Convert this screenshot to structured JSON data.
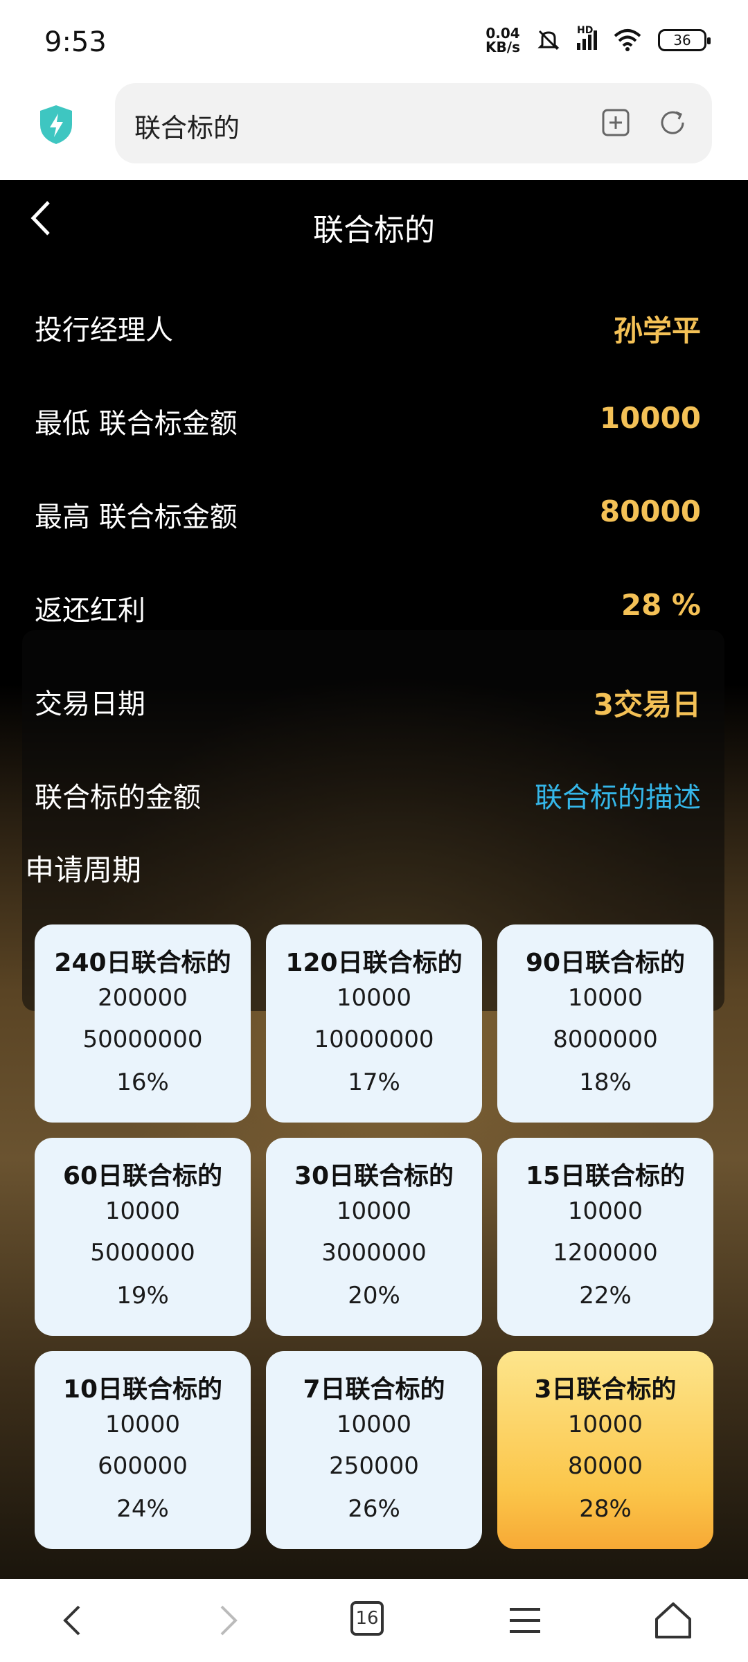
{
  "status_bar": {
    "time": "9:53",
    "net_speed_value": "0.04",
    "net_speed_unit": "KB/s",
    "signal_label": "HD",
    "battery": "36"
  },
  "browser": {
    "url_text": "联合标的"
  },
  "page": {
    "title": "联合标的",
    "info": [
      {
        "label": "投行经理人",
        "value": "孙学平"
      },
      {
        "label": "最低 联合标金额",
        "value": "10000"
      },
      {
        "label": "最高 联合标金额",
        "value": "80000"
      },
      {
        "label": "返还红利",
        "value": "28 %"
      },
      {
        "label": "交易日期",
        "value": "3交易日"
      },
      {
        "label": "联合标的金额",
        "value": "联合标的描述"
      }
    ],
    "section_title": "申请周期",
    "cards": [
      {
        "title": "240日联合标的",
        "min": "200000",
        "max": "50000000",
        "rate": "16%"
      },
      {
        "title": "120日联合标的",
        "min": "10000",
        "max": "10000000",
        "rate": "17%"
      },
      {
        "title": "90日联合标的",
        "min": "10000",
        "max": "8000000",
        "rate": "18%"
      },
      {
        "title": "60日联合标的",
        "min": "10000",
        "max": "5000000",
        "rate": "19%"
      },
      {
        "title": "30日联合标的",
        "min": "10000",
        "max": "3000000",
        "rate": "20%"
      },
      {
        "title": "15日联合标的",
        "min": "10000",
        "max": "1200000",
        "rate": "22%"
      },
      {
        "title": "10日联合标的",
        "min": "10000",
        "max": "600000",
        "rate": "24%"
      },
      {
        "title": "7日联合标的",
        "min": "10000",
        "max": "250000",
        "rate": "26%"
      },
      {
        "title": "3日联合标的",
        "min": "10000",
        "max": "80000",
        "rate": "28%"
      }
    ],
    "selected_card": "3日联合标的"
  },
  "bottom_nav": {
    "tab_count": "16"
  },
  "colors": {
    "value_gold": "#f4c156",
    "link_blue": "#35b6e8",
    "card_bg": "#eaf4fc",
    "card_active": "#fbc64a",
    "shield": "#3ec6c1"
  }
}
